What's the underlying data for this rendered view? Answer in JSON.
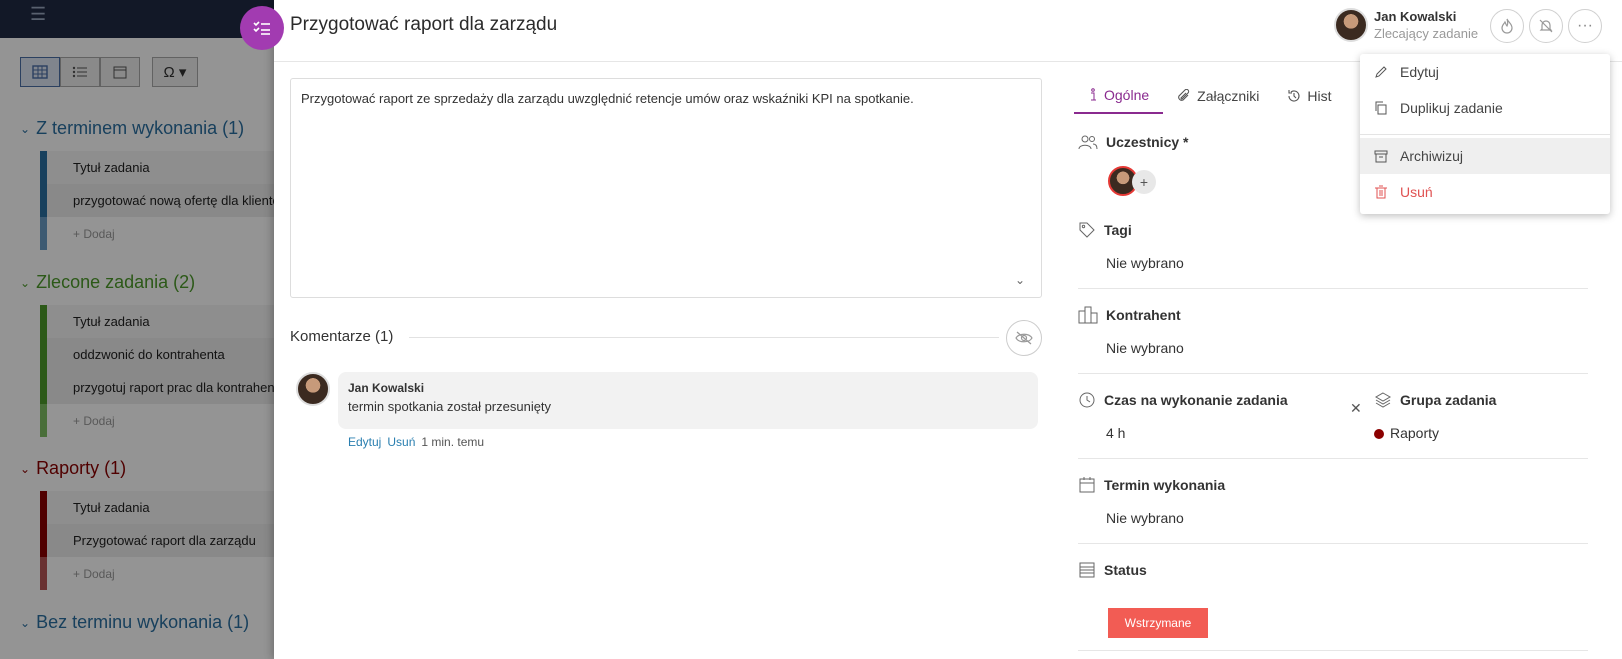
{
  "background": {
    "sections": [
      {
        "title": "Z terminem wykonania (1)",
        "color": "#2a6fa0",
        "rows": [
          "Tytuł zadania",
          "przygotować nową ofertę dla klientów"
        ],
        "add_label": "+ Dodaj"
      },
      {
        "title": "Zlecone zadania (2)",
        "color": "#4c9a2a",
        "rows": [
          "Tytuł zadania",
          "oddzwonić do kontrahenta",
          "przygotuj raport prac dla kontrahenta"
        ],
        "add_label": "+ Dodaj"
      },
      {
        "title": "Raporty (1)",
        "color": "#8b0000",
        "rows": [
          "Tytuł zadania",
          "Przygotować raport dla zarządu"
        ],
        "add_label": "+ Dodaj"
      },
      {
        "title": "Bez terminu wykonania (1)",
        "color": "#2a6fa0",
        "rows": [],
        "add_label": ""
      }
    ]
  },
  "task": {
    "title": "Przygotować raport dla zarządu",
    "owner_name": "Jan Kowalski",
    "owner_role": "Zlecający zadanie",
    "description": "Przygotować raport ze sprzedaży dla zarządu uwzględnić retencje umów oraz wskaźniki KPI na spotkanie.",
    "more_label": "···"
  },
  "comments": {
    "title": "Komentarze (1)",
    "items": [
      {
        "author": "Jan Kowalski",
        "text": "termin spotkania został przesunięty",
        "edit_label": "Edytuj",
        "delete_label": "Usuń",
        "time": "1 min. temu"
      }
    ]
  },
  "tabs": [
    {
      "label": "Ogólne",
      "icon": "info-icon",
      "active": true
    },
    {
      "label": "Załączniki",
      "icon": "paperclip-icon",
      "active": false
    },
    {
      "label": "Hist",
      "icon": "history-icon",
      "active": false
    }
  ],
  "fields": {
    "participants_label": "Uczestnicy *",
    "participants_add": "+",
    "tags_label": "Tagi",
    "tags_value": "Nie wybrano",
    "contractor_label": "Kontrahent",
    "contractor_value": "Nie wybrano",
    "time_label": "Czas na wykonanie zadania",
    "time_value": "4 h",
    "time_clear": "✕",
    "group_label": "Grupa zadania",
    "group_value": "Raporty",
    "group_color": "#8b0000",
    "deadline_label": "Termin wykonania",
    "deadline_value": "Nie wybrano",
    "status_label": "Status",
    "status_value": "Wstrzymane",
    "status_color": "#f25c54"
  },
  "menu": {
    "items": [
      {
        "label": "Edytuj",
        "icon": "pencil-icon"
      },
      {
        "label": "Duplikuj zadanie",
        "icon": "copy-icon"
      },
      {
        "label": "Archiwizuj",
        "icon": "archive-icon"
      },
      {
        "label": "Usuń",
        "icon": "trash-icon"
      }
    ]
  }
}
